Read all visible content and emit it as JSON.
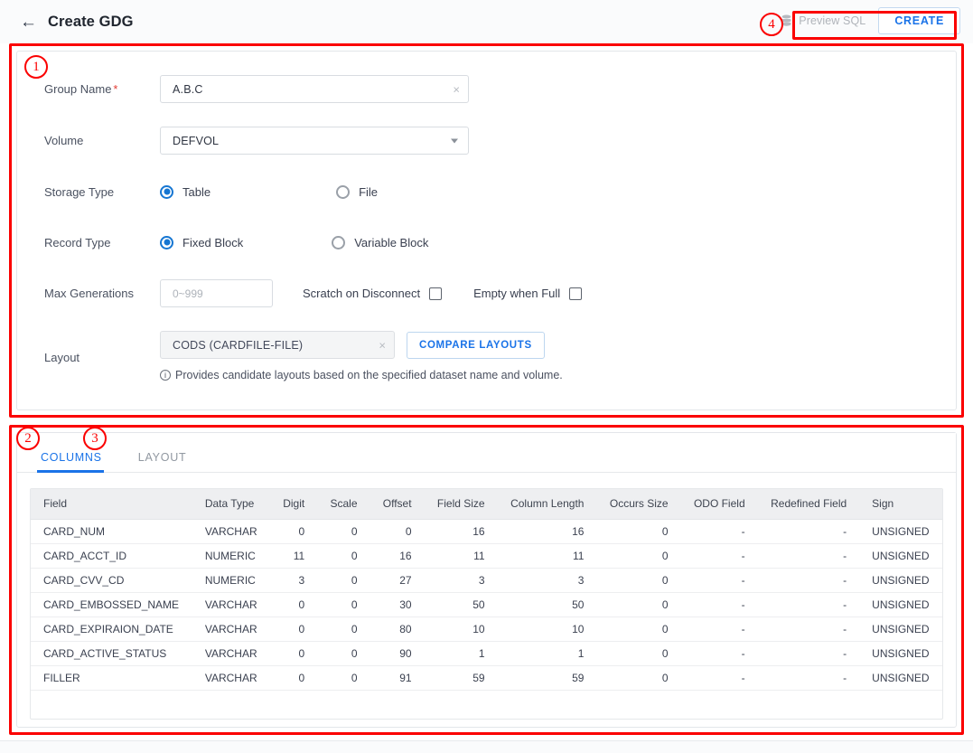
{
  "header": {
    "back_icon": "arrow-left-icon",
    "title": "Create GDG",
    "preview_sql_label": "Preview SQL",
    "preview_sql_icon": "database-icon",
    "create_label": "CREATE"
  },
  "form": {
    "group_name": {
      "label": "Group Name",
      "required_mark": "*",
      "value": "A.B.C",
      "clear_icon": "×"
    },
    "volume": {
      "label": "Volume",
      "value": "DEFVOL"
    },
    "storage_type": {
      "label": "Storage Type",
      "options": [
        {
          "label": "Table",
          "selected": true
        },
        {
          "label": "File",
          "selected": false
        }
      ]
    },
    "record_type": {
      "label": "Record Type",
      "options": [
        {
          "label": "Fixed Block",
          "selected": true
        },
        {
          "label": "Variable Block",
          "selected": false
        }
      ]
    },
    "max_generations": {
      "label": "Max Generations",
      "placeholder": "0~999",
      "value": ""
    },
    "scratch_on_disconnect": {
      "label": "Scratch on Disconnect",
      "checked": false
    },
    "empty_when_full": {
      "label": "Empty when Full",
      "checked": false
    },
    "layout": {
      "label": "Layout",
      "value": "CODS (CARDFILE-FILE)",
      "clear_icon": "×",
      "compare_button": "COMPARE LAYOUTS",
      "hint": "Provides candidate layouts based on the specified dataset name and volume.",
      "hint_icon": "info-icon"
    }
  },
  "tabs": [
    {
      "label": "COLUMNS",
      "active": true
    },
    {
      "label": "LAYOUT",
      "active": false
    }
  ],
  "table": {
    "columns": [
      {
        "label": "Field",
        "align": "l"
      },
      {
        "label": "Data Type",
        "align": "l"
      },
      {
        "label": "Digit",
        "align": "r"
      },
      {
        "label": "Scale",
        "align": "r"
      },
      {
        "label": "Offset",
        "align": "r"
      },
      {
        "label": "Field Size",
        "align": "r"
      },
      {
        "label": "Column Length",
        "align": "r"
      },
      {
        "label": "Occurs Size",
        "align": "r"
      },
      {
        "label": "ODO Field",
        "align": "r"
      },
      {
        "label": "Redefined Field",
        "align": "r"
      },
      {
        "label": "Sign",
        "align": "l"
      }
    ],
    "rows": [
      [
        "CARD_NUM",
        "VARCHAR",
        "0",
        "0",
        "0",
        "16",
        "16",
        "0",
        "-",
        "-",
        "UNSIGNED"
      ],
      [
        "CARD_ACCT_ID",
        "NUMERIC",
        "11",
        "0",
        "16",
        "11",
        "11",
        "0",
        "-",
        "-",
        "UNSIGNED"
      ],
      [
        "CARD_CVV_CD",
        "NUMERIC",
        "3",
        "0",
        "27",
        "3",
        "3",
        "0",
        "-",
        "-",
        "UNSIGNED"
      ],
      [
        "CARD_EMBOSSED_NAME",
        "VARCHAR",
        "0",
        "0",
        "30",
        "50",
        "50",
        "0",
        "-",
        "-",
        "UNSIGNED"
      ],
      [
        "CARD_EXPIRAION_DATE",
        "VARCHAR",
        "0",
        "0",
        "80",
        "10",
        "10",
        "0",
        "-",
        "-",
        "UNSIGNED"
      ],
      [
        "CARD_ACTIVE_STATUS",
        "VARCHAR",
        "0",
        "0",
        "90",
        "1",
        "1",
        "0",
        "-",
        "-",
        "UNSIGNED"
      ],
      [
        "FILLER",
        "VARCHAR",
        "0",
        "0",
        "91",
        "59",
        "59",
        "0",
        "-",
        "-",
        "UNSIGNED"
      ]
    ]
  },
  "annotations": {
    "color": "#fb0000",
    "markers": [
      {
        "id": "1",
        "label": "①"
      },
      {
        "id": "2",
        "label": "②"
      },
      {
        "id": "3",
        "label": "③"
      },
      {
        "id": "4",
        "label": "④"
      }
    ],
    "marker_text": {
      "one": "1",
      "two": "2",
      "three": "3",
      "four": "4"
    }
  }
}
